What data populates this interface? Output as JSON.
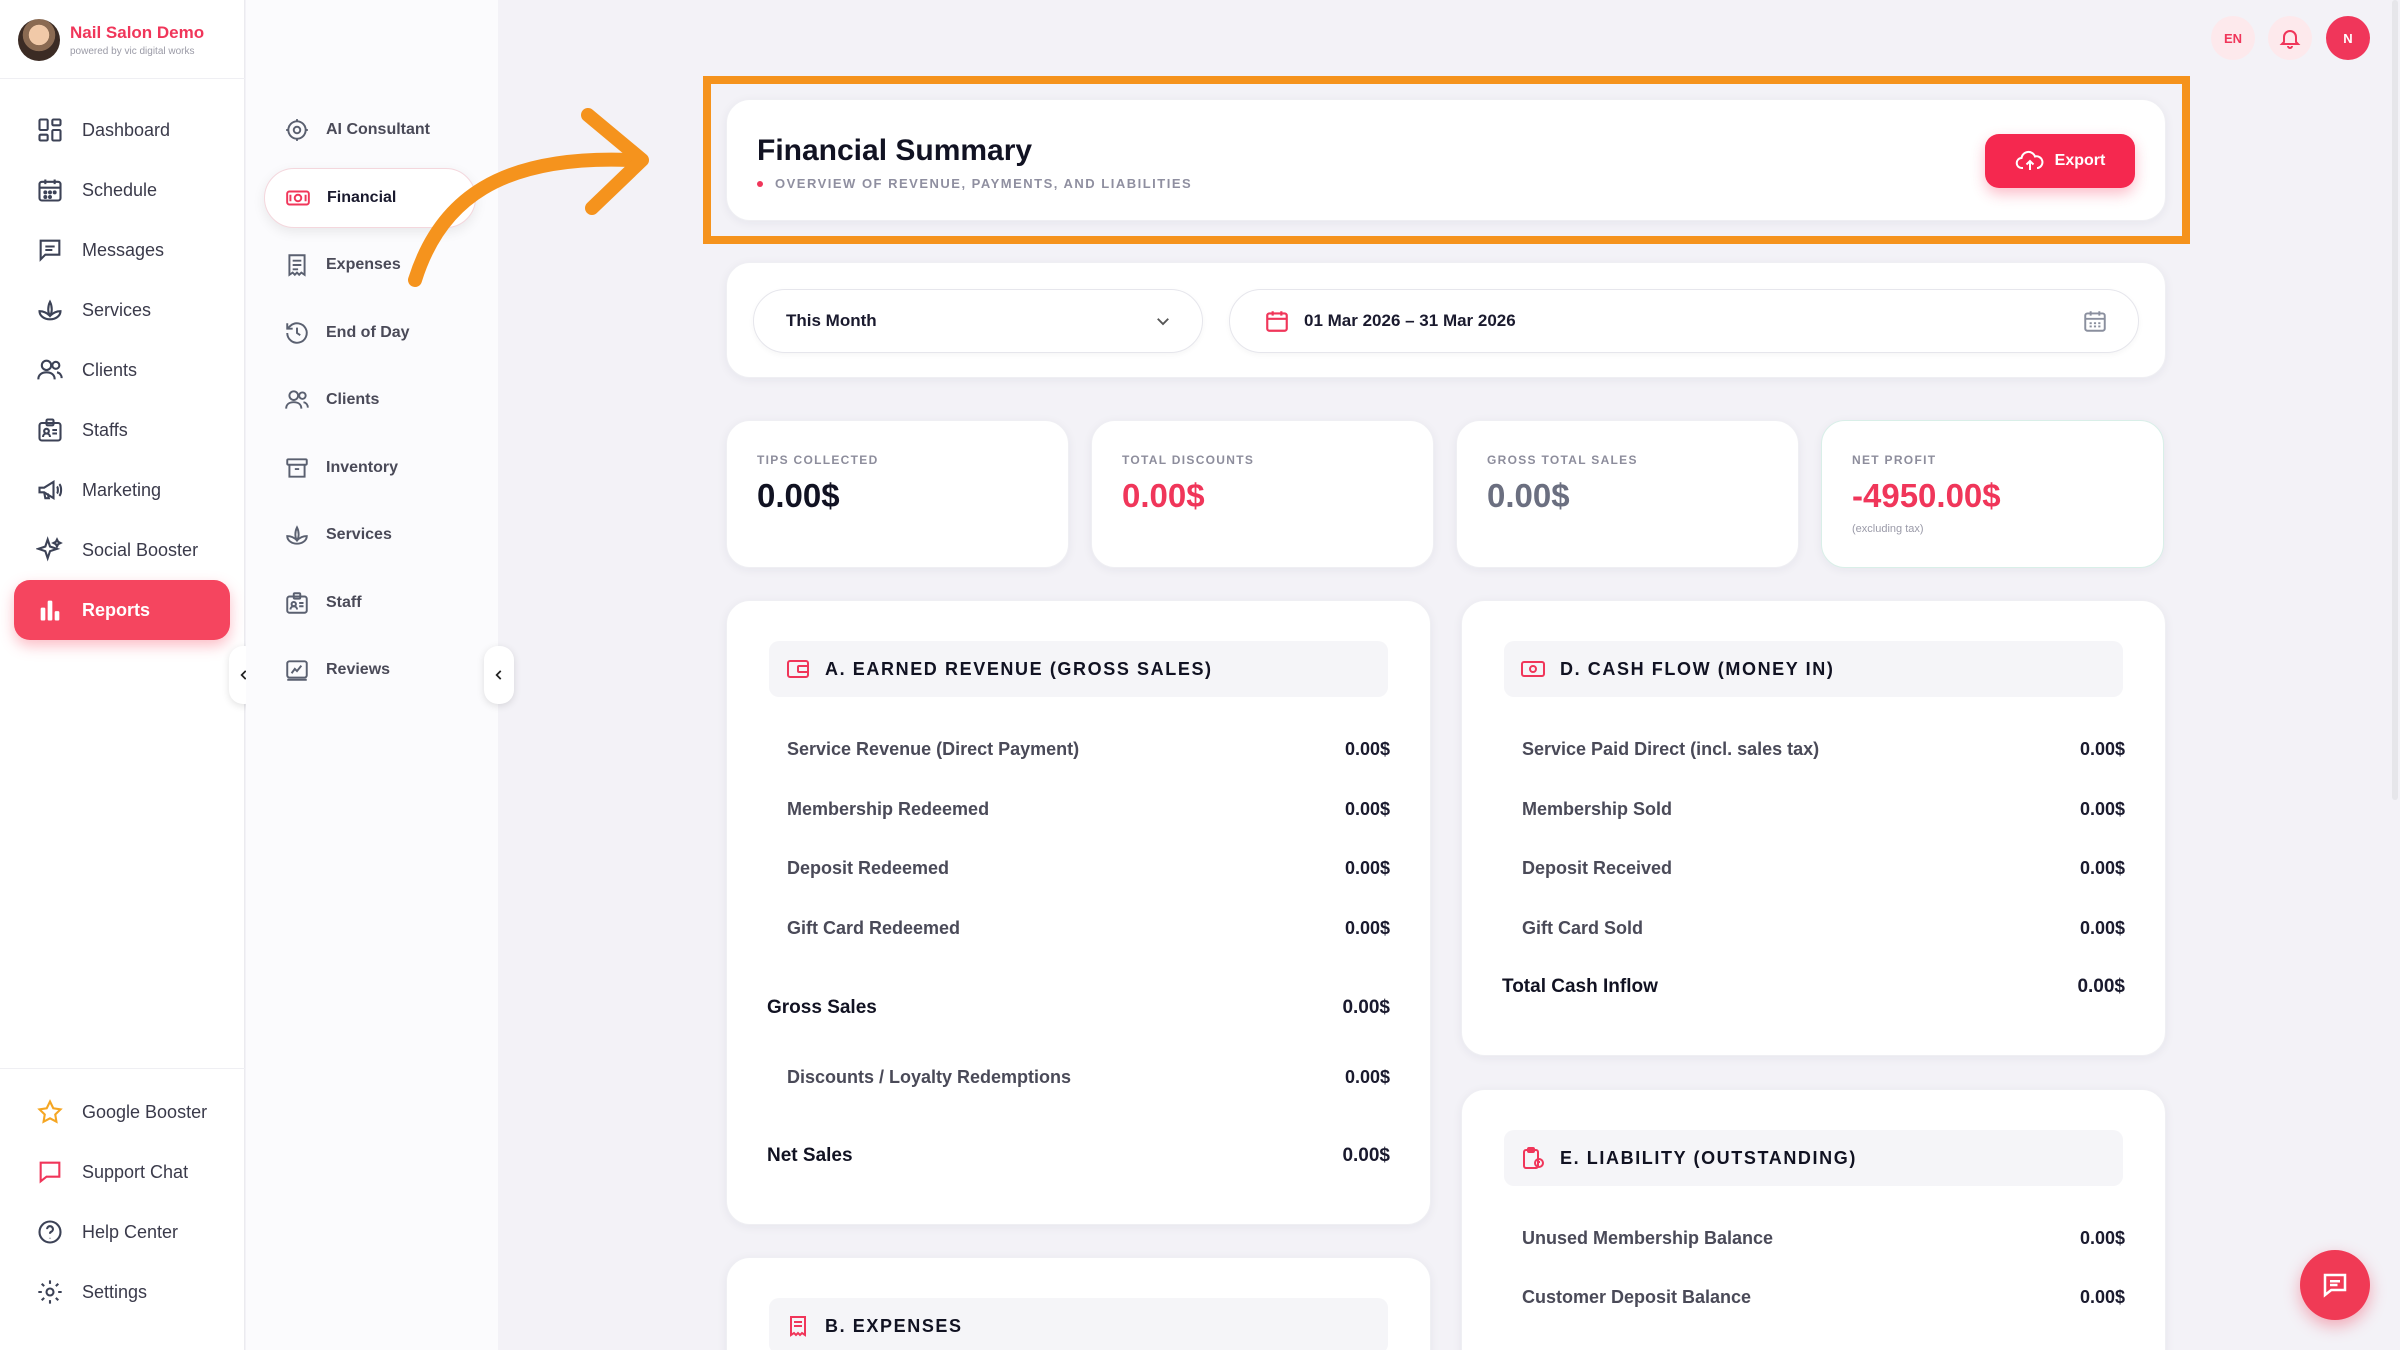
{
  "brand": {
    "name": "Nail Salon Demo",
    "tagline": "powered by vic digital works"
  },
  "primary_nav": [
    {
      "label": "Dashboard",
      "icon": "dashboard-icon"
    },
    {
      "label": "Schedule",
      "icon": "calendar-icon"
    },
    {
      "label": "Messages",
      "icon": "message-icon"
    },
    {
      "label": "Services",
      "icon": "lotus-icon"
    },
    {
      "label": "Clients",
      "icon": "users-icon"
    },
    {
      "label": "Staffs",
      "icon": "id-badge-icon"
    },
    {
      "label": "Marketing",
      "icon": "megaphone-icon"
    },
    {
      "label": "Social Booster",
      "icon": "sparkle-icon"
    },
    {
      "label": "Reports",
      "icon": "bar-chart-icon",
      "active": true
    }
  ],
  "bottom_nav": [
    {
      "label": "Google Booster",
      "icon": "star-icon"
    },
    {
      "label": "Support Chat",
      "icon": "chat-icon"
    },
    {
      "label": "Help Center",
      "icon": "help-icon"
    },
    {
      "label": "Settings",
      "icon": "gear-icon"
    }
  ],
  "secondary_nav": [
    {
      "label": "AI Consultant",
      "icon": "ai-icon"
    },
    {
      "label": "Financial",
      "icon": "cash-icon",
      "active": true
    },
    {
      "label": "Expenses",
      "icon": "receipt-icon"
    },
    {
      "label": "End of Day",
      "icon": "history-icon"
    },
    {
      "label": "Clients",
      "icon": "users-icon"
    },
    {
      "label": "Inventory",
      "icon": "box-icon"
    },
    {
      "label": "Services",
      "icon": "lotus-icon"
    },
    {
      "label": "Staff",
      "icon": "id-badge-icon"
    },
    {
      "label": "Reviews",
      "icon": "review-icon"
    }
  ],
  "topbar": {
    "language": "EN",
    "avatar_initial": "N"
  },
  "header": {
    "title": "Financial Summary",
    "subtitle": "OVERVIEW OF REVENUE, PAYMENTS, AND LIABILITIES",
    "export_label": "Export"
  },
  "filters": {
    "period": "This Month",
    "date_range": "01 Mar 2026 – 31 Mar 2026"
  },
  "stats": [
    {
      "label": "TIPS COLLECTED",
      "value": "0.00$",
      "color": "#111222"
    },
    {
      "label": "TOTAL DISCOUNTS",
      "value": "0.00$",
      "color": "#f0365a"
    },
    {
      "label": "GROSS TOTAL SALES",
      "value": "0.00$",
      "color": "#6b6f80"
    },
    {
      "label": "NET PROFIT",
      "value": "-4950.00$",
      "color": "#f0365a",
      "note": "(excluding tax)"
    }
  ],
  "sections": {
    "earned_revenue": {
      "title": "A. EARNED REVENUE (GROSS SALES)",
      "rows": [
        {
          "label": "Service Revenue (Direct Payment)",
          "value": "0.00$"
        },
        {
          "label": "Membership Redeemed",
          "value": "0.00$"
        },
        {
          "label": "Deposit Redeemed",
          "value": "0.00$"
        },
        {
          "label": "Gift Card Redeemed",
          "value": "0.00$"
        }
      ],
      "gross_sales": {
        "label": "Gross Sales",
        "value": "0.00$"
      },
      "discounts": {
        "label": "Discounts / Loyalty Redemptions",
        "value": "0.00$"
      },
      "net_sales": {
        "label": "Net Sales",
        "value": "0.00$"
      }
    },
    "cash_flow": {
      "title": "D. CASH FLOW (MONEY IN)",
      "rows": [
        {
          "label": "Service Paid Direct (incl. sales tax)",
          "value": "0.00$"
        },
        {
          "label": "Membership Sold",
          "value": "0.00$"
        },
        {
          "label": "Deposit Received",
          "value": "0.00$"
        },
        {
          "label": "Gift Card Sold",
          "value": "0.00$"
        }
      ],
      "total": {
        "label": "Total Cash Inflow",
        "value": "0.00$"
      }
    },
    "expenses": {
      "title": "B. EXPENSES"
    },
    "liability": {
      "title": "E. LIABILITY (OUTSTANDING)",
      "rows": [
        {
          "label": "Unused Membership Balance",
          "value": "0.00$"
        },
        {
          "label": "Customer Deposit Balance",
          "value": "0.00$"
        }
      ]
    }
  },
  "colors": {
    "accent": "#f0365a",
    "highlight": "#f5931d"
  }
}
